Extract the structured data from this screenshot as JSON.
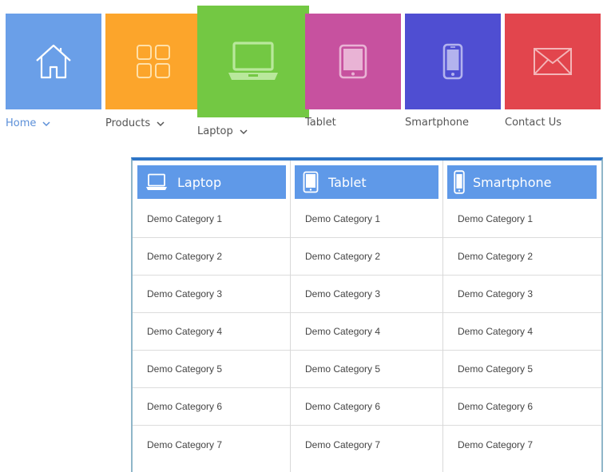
{
  "nav": {
    "items": [
      {
        "label": "Home",
        "color": "#6a9fe8",
        "icon": "home-icon",
        "active": true
      },
      {
        "label": "Products",
        "color": "#fca52b",
        "icon": "grid-icon"
      },
      {
        "label": "Laptop",
        "color": "#73c843",
        "icon": "laptop-icon",
        "expanded": true
      },
      {
        "label": "Tablet",
        "color": "#c7519f",
        "icon": "tablet-icon"
      },
      {
        "label": "Smartphone",
        "color": "#4f4ed2",
        "icon": "smartphone-icon"
      },
      {
        "label": "Contact Us",
        "color": "#e2454d",
        "icon": "mail-icon"
      }
    ]
  },
  "dropdown": {
    "accent": "#5f99e8",
    "columns": [
      {
        "title": "Laptop",
        "icon": "laptop-icon",
        "items": [
          "Demo Category 1",
          "Demo Category 2",
          "Demo Category 3",
          "Demo Category 4",
          "Demo Category 5",
          "Demo Category 6",
          "Demo Category 7"
        ]
      },
      {
        "title": "Tablet",
        "icon": "tablet-icon",
        "items": [
          "Demo Category 1",
          "Demo Category 2",
          "Demo Category 3",
          "Demo Category 4",
          "Demo Category 5",
          "Demo Category 6",
          "Demo Category 7"
        ]
      },
      {
        "title": "Smartphone",
        "icon": "smartphone-icon",
        "items": [
          "Demo Category 1",
          "Demo Category 2",
          "Demo Category 3",
          "Demo Category 4",
          "Demo Category 5",
          "Demo Category 6",
          "Demo Category 7"
        ]
      }
    ]
  }
}
